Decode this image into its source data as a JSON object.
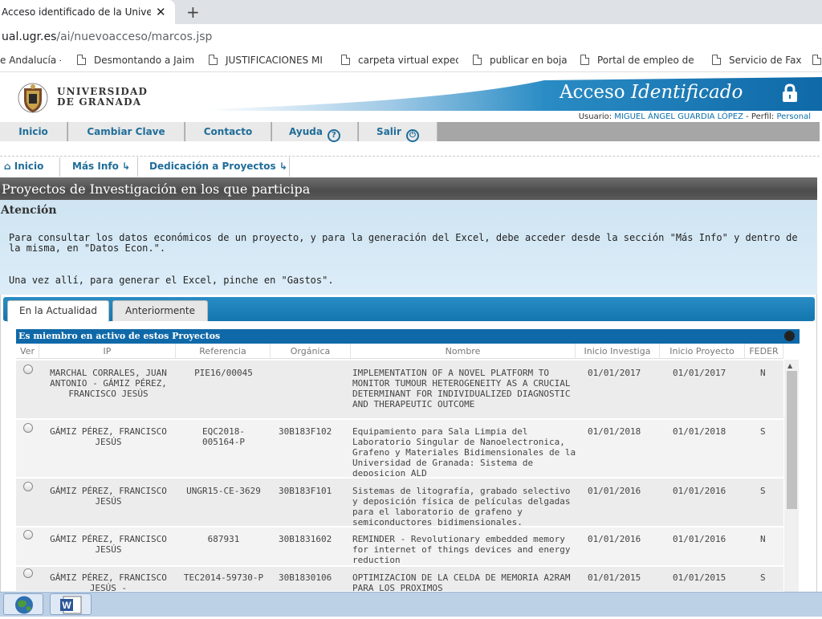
{
  "browser": {
    "tab_title": "Acceso identificado de la Universidad de Granada",
    "url_domain": "ual.ugr.es",
    "url_path": "/ai/nuevoacceso/marcos.jsp",
    "bookmarks": [
      "e Andalucía -",
      "Desmontando a Jaime",
      "JUSTIFICACIONES MI",
      "carpeta virtual expedi",
      "publicar en boja",
      "Portal de empleo de",
      "Servicio de Fax"
    ]
  },
  "header": {
    "university_line1": "UNIVERSIDAD",
    "university_line2": "DE GRANADA",
    "title_regular": "Acceso ",
    "title_italic": "Identificado",
    "user_label": "Usuario: ",
    "user_name": "MIGUEL ÁNGEL GUARDIA LÓPEZ",
    "profile_label": " - Perfil: ",
    "profile_value": "Personal"
  },
  "topmenu": {
    "inicio": "Inicio",
    "cambiar_clave": "Cambiar Clave",
    "contacto": "Contacto",
    "ayuda": "Ayuda",
    "salir": "Salir"
  },
  "breadcrumb": {
    "inicio": "Inicio",
    "mas_info": "Más Info",
    "dedicacion": "Dedicación a Proyectos"
  },
  "section": {
    "title": "Proyectos de Investigación en los que participa",
    "notice_heading": "Atención",
    "notice_p1": "Para consultar los datos económicos de un proyecto, y para la generación del Excel, debe acceder desde la sección \"Más Info\" y dentro de la misma, en \"Datos Econ.\".",
    "notice_p2": "Una vez allí, para generar el Excel, pinche en \"Gastos\"."
  },
  "tabs": {
    "active": "En la Actualidad",
    "inactive": "Anteriormente"
  },
  "grid": {
    "title": "Es miembro en activo de estos Proyectos",
    "columns": [
      "Ver",
      "IP",
      "Referencia",
      "Orgánica",
      "Nombre",
      "Inicio Investiga",
      "Inicio Proyecto",
      "FEDER"
    ],
    "rows": [
      {
        "ip": "MARCHAL CORRALES, JUAN ANTONIO - GÁMIZ PÉREZ, FRANCISCO JESÚS",
        "referencia": "PIE16/00045",
        "organica": "",
        "nombre": "IMPLEMENTATION OF A NOVEL PLATFORM TO MONITOR TUMOUR HETEROGENEITY AS A CRUCIAL DETERMINANT FOR INDIVIDUALIZED DIAGNOSTIC AND THERAPEUTIC OUTCOME",
        "inicio_investiga": "01/01/2017",
        "inicio_proyecto": "01/01/2017",
        "feder": "N"
      },
      {
        "ip": "GÁMIZ PÉREZ, FRANCISCO JESÚS",
        "referencia": "EQC2018-005164-P",
        "organica": "30B183F102",
        "nombre": "Equipamiento para Sala Limpia del Laboratorio Singular de Nanoelectronica, Grafeno y Materiales Bidimensionales de la Universidad de Granada: Sistema de deposicion ALD",
        "inicio_investiga": "01/01/2018",
        "inicio_proyecto": "01/01/2018",
        "feder": "S"
      },
      {
        "ip": "GÁMIZ PÉREZ, FRANCISCO JESÚS",
        "referencia": "UNGR15-CE-3629",
        "organica": "30B183F101",
        "nombre": "Sistemas de litografía, grabado selectivo y deposición física de películas delgadas para el laboratorio de grafeno y semiconductores bidimensionales.",
        "inicio_investiga": "01/01/2016",
        "inicio_proyecto": "01/01/2016",
        "feder": "S"
      },
      {
        "ip": "GÁMIZ PÉREZ, FRANCISCO JESÚS",
        "referencia": "687931",
        "organica": "30B1831602",
        "nombre": "REMINDER - Revolutionary embedded memory for internet of things devices and energy reduction",
        "inicio_investiga": "01/01/2016",
        "inicio_proyecto": "01/01/2016",
        "feder": "N"
      },
      {
        "ip": "GÁMIZ PÉREZ, FRANCISCO JESÚS -",
        "referencia": "TEC2014-59730-P",
        "organica": "30B1830106",
        "nombre": "OPTIMIZACION DE LA CELDA DE MEMORIA A2RAM PARA LOS PROXIMOS",
        "inicio_investiga": "01/01/2015",
        "inicio_proyecto": "01/01/2015",
        "feder": "S"
      }
    ]
  },
  "colors": {
    "brand_blue": "#1476ae",
    "link_blue": "#1f6d99",
    "section_gray": "#5a5a5a"
  }
}
